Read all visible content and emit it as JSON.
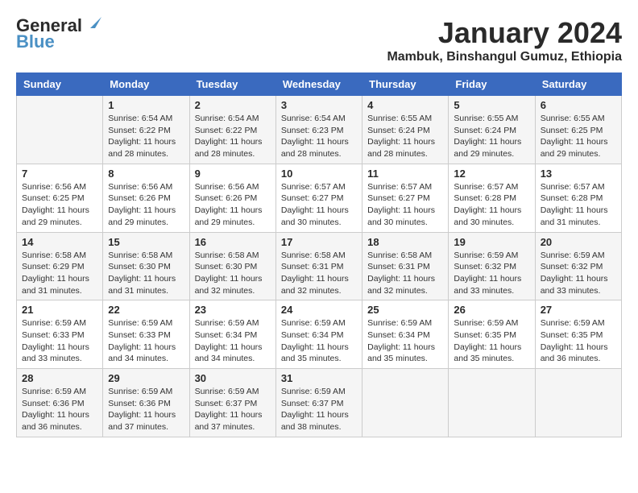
{
  "header": {
    "logo_line1": "General",
    "logo_line2": "Blue",
    "title": "January 2024",
    "subtitle": "Mambuk, Binshangul Gumuz, Ethiopia"
  },
  "calendar": {
    "headers": [
      "Sunday",
      "Monday",
      "Tuesday",
      "Wednesday",
      "Thursday",
      "Friday",
      "Saturday"
    ],
    "rows": [
      [
        {
          "day": "",
          "info": ""
        },
        {
          "day": "1",
          "info": "Sunrise: 6:54 AM\nSunset: 6:22 PM\nDaylight: 11 hours\nand 28 minutes."
        },
        {
          "day": "2",
          "info": "Sunrise: 6:54 AM\nSunset: 6:22 PM\nDaylight: 11 hours\nand 28 minutes."
        },
        {
          "day": "3",
          "info": "Sunrise: 6:54 AM\nSunset: 6:23 PM\nDaylight: 11 hours\nand 28 minutes."
        },
        {
          "day": "4",
          "info": "Sunrise: 6:55 AM\nSunset: 6:24 PM\nDaylight: 11 hours\nand 28 minutes."
        },
        {
          "day": "5",
          "info": "Sunrise: 6:55 AM\nSunset: 6:24 PM\nDaylight: 11 hours\nand 29 minutes."
        },
        {
          "day": "6",
          "info": "Sunrise: 6:55 AM\nSunset: 6:25 PM\nDaylight: 11 hours\nand 29 minutes."
        }
      ],
      [
        {
          "day": "7",
          "info": "Sunrise: 6:56 AM\nSunset: 6:25 PM\nDaylight: 11 hours\nand 29 minutes."
        },
        {
          "day": "8",
          "info": "Sunrise: 6:56 AM\nSunset: 6:26 PM\nDaylight: 11 hours\nand 29 minutes."
        },
        {
          "day": "9",
          "info": "Sunrise: 6:56 AM\nSunset: 6:26 PM\nDaylight: 11 hours\nand 29 minutes."
        },
        {
          "day": "10",
          "info": "Sunrise: 6:57 AM\nSunset: 6:27 PM\nDaylight: 11 hours\nand 30 minutes."
        },
        {
          "day": "11",
          "info": "Sunrise: 6:57 AM\nSunset: 6:27 PM\nDaylight: 11 hours\nand 30 minutes."
        },
        {
          "day": "12",
          "info": "Sunrise: 6:57 AM\nSunset: 6:28 PM\nDaylight: 11 hours\nand 30 minutes."
        },
        {
          "day": "13",
          "info": "Sunrise: 6:57 AM\nSunset: 6:28 PM\nDaylight: 11 hours\nand 31 minutes."
        }
      ],
      [
        {
          "day": "14",
          "info": "Sunrise: 6:58 AM\nSunset: 6:29 PM\nDaylight: 11 hours\nand 31 minutes."
        },
        {
          "day": "15",
          "info": "Sunrise: 6:58 AM\nSunset: 6:30 PM\nDaylight: 11 hours\nand 31 minutes."
        },
        {
          "day": "16",
          "info": "Sunrise: 6:58 AM\nSunset: 6:30 PM\nDaylight: 11 hours\nand 32 minutes."
        },
        {
          "day": "17",
          "info": "Sunrise: 6:58 AM\nSunset: 6:31 PM\nDaylight: 11 hours\nand 32 minutes."
        },
        {
          "day": "18",
          "info": "Sunrise: 6:58 AM\nSunset: 6:31 PM\nDaylight: 11 hours\nand 32 minutes."
        },
        {
          "day": "19",
          "info": "Sunrise: 6:59 AM\nSunset: 6:32 PM\nDaylight: 11 hours\nand 33 minutes."
        },
        {
          "day": "20",
          "info": "Sunrise: 6:59 AM\nSunset: 6:32 PM\nDaylight: 11 hours\nand 33 minutes."
        }
      ],
      [
        {
          "day": "21",
          "info": "Sunrise: 6:59 AM\nSunset: 6:33 PM\nDaylight: 11 hours\nand 33 minutes."
        },
        {
          "day": "22",
          "info": "Sunrise: 6:59 AM\nSunset: 6:33 PM\nDaylight: 11 hours\nand 34 minutes."
        },
        {
          "day": "23",
          "info": "Sunrise: 6:59 AM\nSunset: 6:34 PM\nDaylight: 11 hours\nand 34 minutes."
        },
        {
          "day": "24",
          "info": "Sunrise: 6:59 AM\nSunset: 6:34 PM\nDaylight: 11 hours\nand 35 minutes."
        },
        {
          "day": "25",
          "info": "Sunrise: 6:59 AM\nSunset: 6:34 PM\nDaylight: 11 hours\nand 35 minutes."
        },
        {
          "day": "26",
          "info": "Sunrise: 6:59 AM\nSunset: 6:35 PM\nDaylight: 11 hours\nand 35 minutes."
        },
        {
          "day": "27",
          "info": "Sunrise: 6:59 AM\nSunset: 6:35 PM\nDaylight: 11 hours\nand 36 minutes."
        }
      ],
      [
        {
          "day": "28",
          "info": "Sunrise: 6:59 AM\nSunset: 6:36 PM\nDaylight: 11 hours\nand 36 minutes."
        },
        {
          "day": "29",
          "info": "Sunrise: 6:59 AM\nSunset: 6:36 PM\nDaylight: 11 hours\nand 37 minutes."
        },
        {
          "day": "30",
          "info": "Sunrise: 6:59 AM\nSunset: 6:37 PM\nDaylight: 11 hours\nand 37 minutes."
        },
        {
          "day": "31",
          "info": "Sunrise: 6:59 AM\nSunset: 6:37 PM\nDaylight: 11 hours\nand 38 minutes."
        },
        {
          "day": "",
          "info": ""
        },
        {
          "day": "",
          "info": ""
        },
        {
          "day": "",
          "info": ""
        }
      ]
    ]
  }
}
